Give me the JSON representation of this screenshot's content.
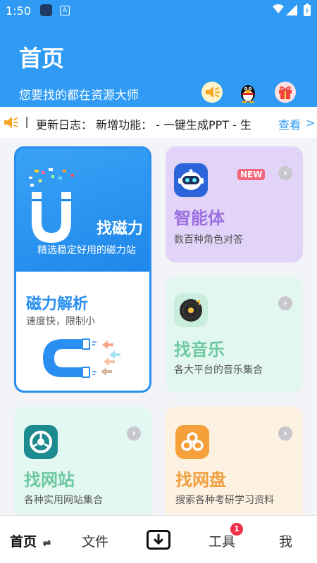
{
  "status_bar": {
    "time": "1:50",
    "app_badge": "A"
  },
  "header": {
    "title": "首页",
    "subtitle": "您要找的都在资源大师",
    "color": "#2f9bf4"
  },
  "notice": {
    "text": "更新日志：  新增功能：    - 一键生成PPT - 生",
    "more_label": "查看",
    "more_chevron": ">"
  },
  "cards": {
    "magnet": {
      "title": "找磁力",
      "desc": "精选稳定好用的磁力站",
      "sub_title": "磁力解析",
      "sub_desc": "速度快，限制小"
    },
    "agent": {
      "title": "智能体",
      "desc": "数百种角色对答",
      "badge": "NEW",
      "chevron": "›"
    },
    "music": {
      "title": "找音乐",
      "desc": "各大平台的音乐集合",
      "chevron": "›"
    },
    "website": {
      "title": "找网站",
      "desc": "各种实用网站集合",
      "chevron": "›"
    },
    "netdisk": {
      "title": "找网盘",
      "desc": "搜索各种考研学习资料",
      "chevron": "›"
    }
  },
  "bottom_nav": {
    "home": "首页",
    "home_switch": "⇌",
    "files": "文件",
    "tools": "工具",
    "tools_badge": "1",
    "me": "我"
  },
  "icons": {
    "download": "download-icon",
    "speaker": "speaker-icon",
    "penguin": "qq-penguin-icon",
    "gift": "gift-icon"
  }
}
